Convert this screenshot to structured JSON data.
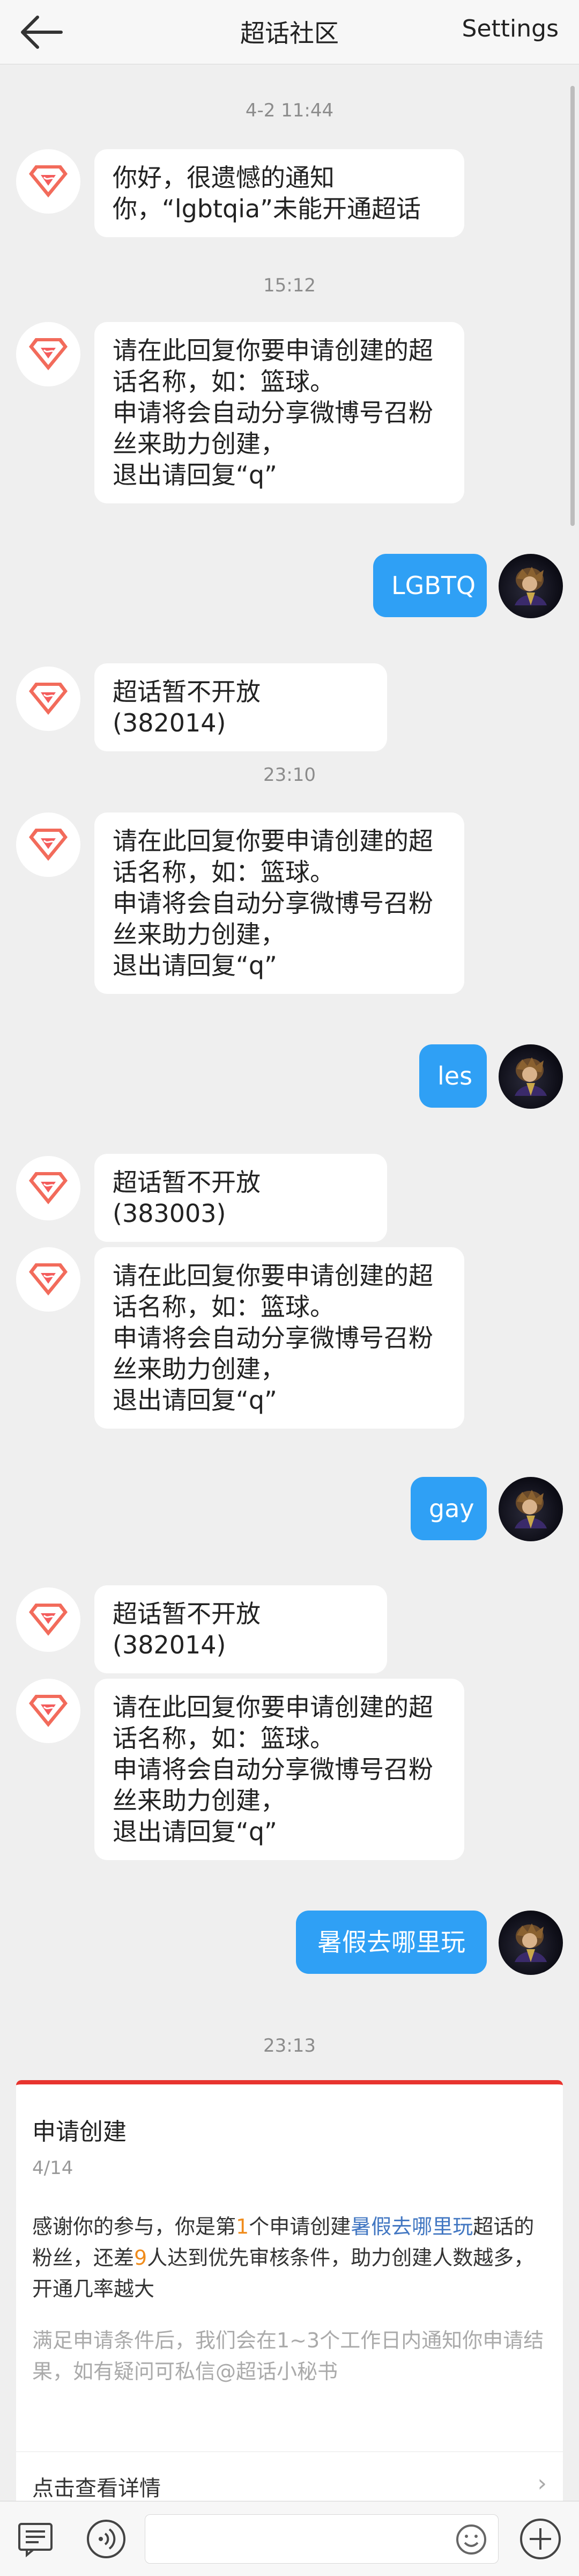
{
  "header": {
    "title": "超话社区",
    "settings_label": "Settings",
    "back_icon": "back-arrow-icon"
  },
  "messages": {
    "ts1": "4-2 11:44",
    "sys1": "你好，很遗憾的通知你，“lgbtqia”未能开通超话",
    "ts2": "15:12",
    "sys2": "请在此回复你要申请创建的超话名称，如：篮球。\n申请将会自动分享微博号召粉丝来助力创建，\n退出请回复“q”",
    "user1": "LGBTQ",
    "sys3": "超话暂不开放(382014)",
    "ts3": "23:10",
    "sys4": "请在此回复你要申请创建的超话名称，如：篮球。\n申请将会自动分享微博号召粉丝来助力创建，\n退出请回复“q”",
    "user2": "les",
    "sys5": "超话暂不开放(383003)",
    "sys6": "请在此回复你要申请创建的超话名称，如：篮球。\n申请将会自动分享微博号召粉丝来助力创建，\n退出请回复“q”",
    "user3": "gay",
    "sys7": "超话暂不开放(382014)",
    "sys8": "请在此回复你要申请创建的超话名称，如：篮球。\n申请将会自动分享微博号召粉丝来助力创建，\n退出请回复“q”",
    "user4": "暑假去哪里玩",
    "ts4": "23:13"
  },
  "card": {
    "title": "申请创建",
    "date": "4/14",
    "body_pre": "感谢你的参与，你是第",
    "rank": "1",
    "body_mid": "个申请创建",
    "topic": "暑假去哪里玩",
    "body_mid2": "超话的粉丝，还差",
    "remaining": "9",
    "body_post": "人达到优先审核条件，助力创建人数越多，开通几率越大",
    "note": "满足申请条件后，我们会在1~3个工作日内通知你申请结果，如有疑问可私信@超话小秘书",
    "link_label": "点击查看详情",
    "accent_color": "#e8342e"
  },
  "footer": {
    "menu_icon": "keyboard-menu-icon",
    "voice_icon": "voice-icon",
    "emoji_icon": "emoji-icon",
    "add_icon": "plus-circle-icon"
  },
  "colors": {
    "outgoing_bubble": "#2fa0f5",
    "background": "#efefef"
  }
}
